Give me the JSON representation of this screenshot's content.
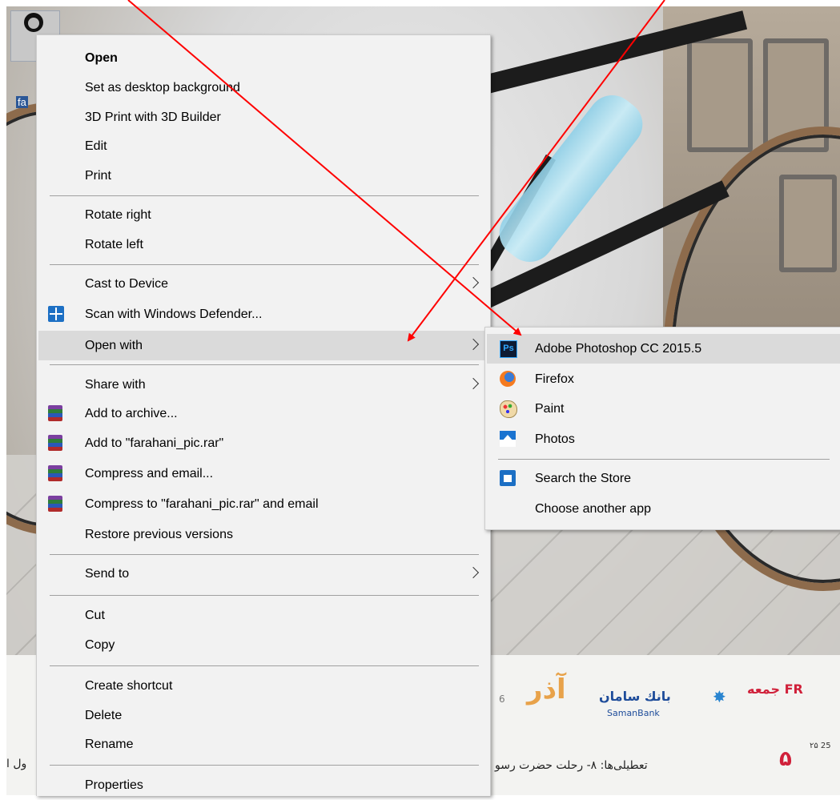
{
  "desktop": {
    "file_icon_label": "fa"
  },
  "calendar": {
    "day_label": "جمعه FR",
    "month": "آذر",
    "bank_name": "بانك سامان",
    "bank_name_en": "SamanBank",
    "date_fa": "۵",
    "date_small": "۲۵ 25",
    "holiday_text": "تعطیلی‌ها: ۸- رحلت حضرت رسو",
    "left_text": "ول ا",
    "number_6": "6"
  },
  "context_menu": {
    "items": [
      {
        "label": "Open",
        "bold": true
      },
      {
        "label": "Set as desktop background"
      },
      {
        "label": "3D Print with 3D Builder"
      },
      {
        "label": "Edit"
      },
      {
        "label": "Print"
      },
      {
        "label": "Rotate right"
      },
      {
        "label": "Rotate left"
      },
      {
        "label": "Cast to Device",
        "submenu": true
      },
      {
        "label": "Scan with Windows Defender...",
        "icon": "windows-defender-icon"
      },
      {
        "label": "Open with",
        "submenu": true,
        "highlighted": true
      },
      {
        "label": "Share with",
        "submenu": true
      },
      {
        "label": "Add to archive...",
        "icon": "winrar-icon"
      },
      {
        "label": "Add to \"farahani_pic.rar\"",
        "icon": "winrar-icon"
      },
      {
        "label": "Compress and email...",
        "icon": "winrar-icon"
      },
      {
        "label": "Compress to \"farahani_pic.rar\" and email",
        "icon": "winrar-icon"
      },
      {
        "label": "Restore previous versions"
      },
      {
        "label": "Send to",
        "submenu": true
      },
      {
        "label": "Cut"
      },
      {
        "label": "Copy"
      },
      {
        "label": "Create shortcut"
      },
      {
        "label": "Delete"
      },
      {
        "label": "Rename"
      },
      {
        "label": "Properties"
      }
    ]
  },
  "open_with_submenu": {
    "items": [
      {
        "label": "Adobe Photoshop CC 2015.5",
        "icon": "photoshop-icon",
        "icon_text": "Ps",
        "highlighted": true
      },
      {
        "label": "Firefox",
        "icon": "firefox-icon"
      },
      {
        "label": "Paint",
        "icon": "paint-icon"
      },
      {
        "label": "Photos",
        "icon": "photos-icon"
      },
      {
        "label": "Search the Store",
        "icon": "store-icon"
      },
      {
        "label": "Choose another app"
      }
    ]
  },
  "annotation": {
    "arrow_color": "#ff0000"
  },
  "colors": {
    "menu_background": "#f2f2f2",
    "menu_highlight": "#dadada",
    "separator": "#a0a0a0"
  }
}
